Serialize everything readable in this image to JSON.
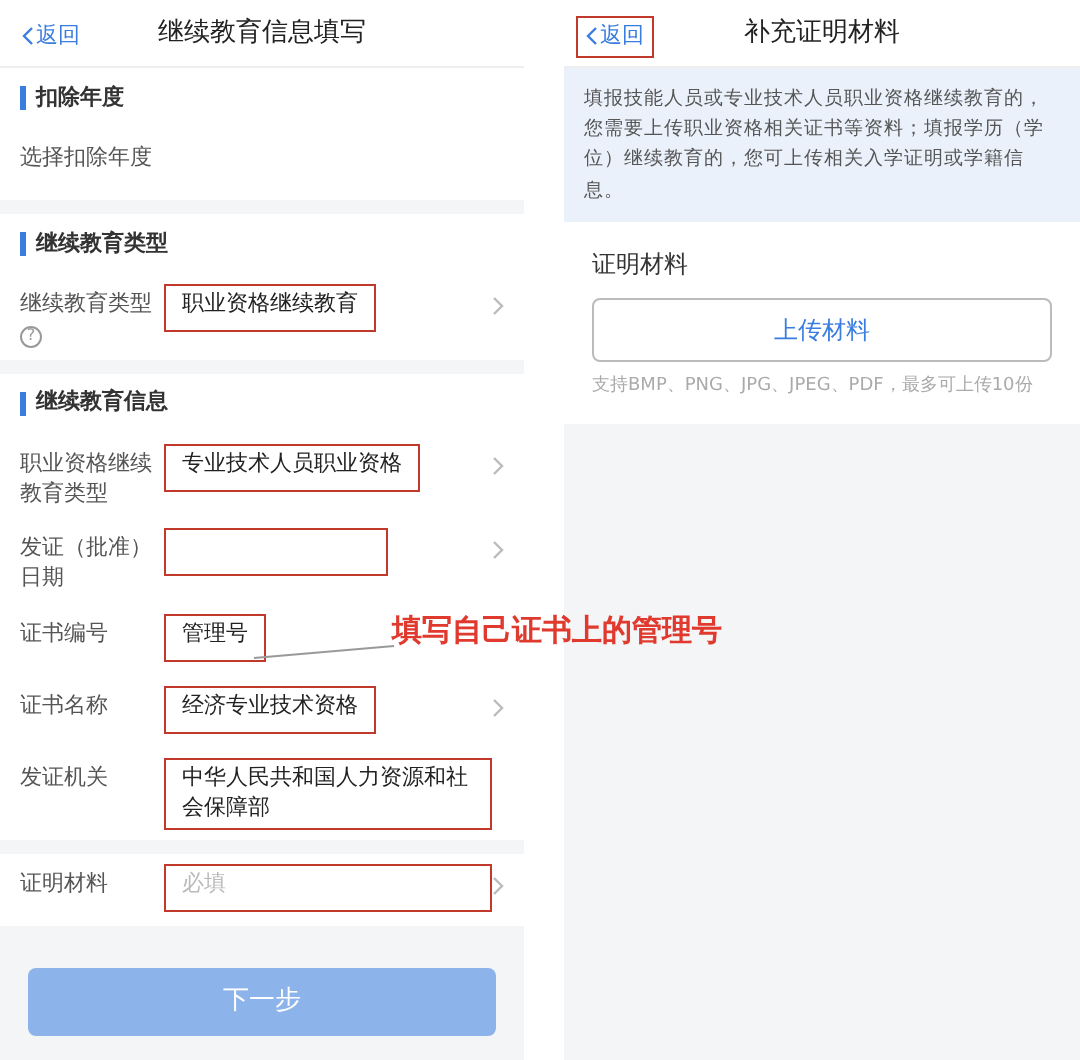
{
  "left_screen": {
    "back": "返回",
    "title": "继续教育信息填写",
    "sections": [
      {
        "heading": "扣除年度",
        "rows": [
          {
            "label": "选择扣除年度"
          }
        ]
      },
      {
        "heading": "继续教育类型",
        "rows": [
          {
            "label": "继续教育类型",
            "help": "?",
            "value": "职业资格继续教育",
            "chevron": true,
            "highlighted": true
          }
        ]
      },
      {
        "heading": "继续教育信息",
        "rows": [
          {
            "label": "职业资格继续教育类型",
            "value": "专业技术人员职业资格",
            "chevron": true,
            "highlighted": true
          },
          {
            "label": "发证（批准）日期",
            "chevron": true,
            "highlighted": true
          },
          {
            "label": "证书编号",
            "value": "管理号",
            "chevron": false,
            "highlighted": true
          },
          {
            "label": "证书名称",
            "value": "经济专业技术资格",
            "chevron": true,
            "highlighted": true
          },
          {
            "label": "发证机关",
            "value": "中华人民共和国人力资源和社会保障部",
            "chevron": false,
            "highlighted": true
          }
        ]
      },
      {
        "rows": [
          {
            "label": "证明材料",
            "placeholder": "必填",
            "chevron": true,
            "highlighted": true
          }
        ]
      }
    ],
    "next_button": {
      "label": "下一步",
      "disabled": true
    }
  },
  "annotation": {
    "text": "填写自己证书上的管理号"
  },
  "right_screen": {
    "back": "返回",
    "back_highlighted": true,
    "title": "补充证明材料",
    "notice": "填报技能人员或专业技术人员职业资格继续教育的，您需要上传职业资格相关证书等资料；填报学历（学位）继续教育的，您可上传相关入学证明或学籍信息。",
    "field_label": "证明材料",
    "upload_button": "上传材料",
    "hint": "支持BMP、PNG、JPG、JPEG、PDF，最多可上传10份"
  }
}
